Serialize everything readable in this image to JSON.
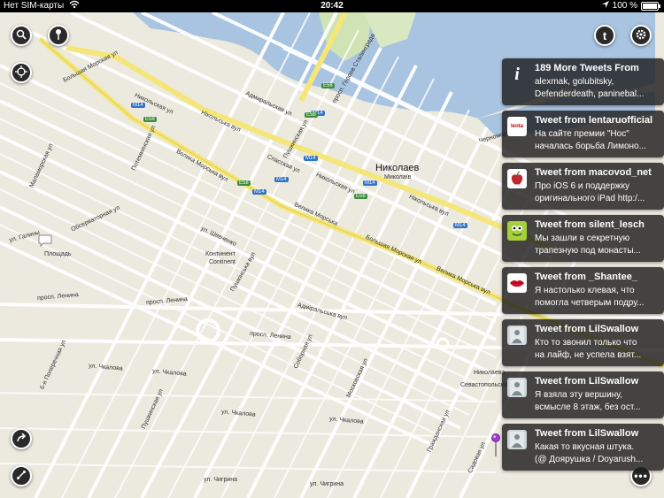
{
  "status_bar": {
    "carrier": "Нет SIM-карты",
    "time": "20:42",
    "battery": "100 %",
    "battery_level": 1.0
  },
  "map": {
    "city": "Николаев",
    "city_small": "Миколаїв",
    "labels": {
      "bolshaya_morskaya_1": "Большая Морская ул",
      "velyka_morska_1": "Велика Морська вул",
      "nikolskaya": "Никольская ул",
      "nikolska_ua": "Нікольська вул",
      "nikolskaya_2": "Никольская ул",
      "nikolska_ua_2": "Нікольська вул",
      "velyka_morska_2": "Велика Морська",
      "bolshaya_morskaya_2": "Большая Морская ул",
      "velyka_morska_3": "Велика Морська вул",
      "prosp_lenina_1": "просп. Ленина",
      "prosp_lenina_2": "просп. Ленина",
      "prosp_lenina_3": "просп. Ленина",
      "chkalova_1": "ул. Чкалова",
      "chkalova_2": "ул. Чкалова",
      "chkalova_3": "ул. Чкалова",
      "chkalova_4": "ул. Чкалова",
      "chigrina_1": "ул. Чигрина",
      "chigrina_2": "ул. Чигрина",
      "pushkinskaya_1": "Пушкинская ул",
      "pushkinskaya_2": "Пушкинская ул",
      "pushkinska": "Пушкінська вул",
      "spasskaya": "Спасская ул",
      "admiralskaya": "Адмиральская ул",
      "admiralska": "Адміральська вул",
      "shevchenko": "ул. Шевченко",
      "potemkinskaya": "Потемкинская ул",
      "sobornaya": "Соборная ул",
      "moskovskaya": "Московская ул",
      "kontinent": "Континент",
      "kontinent_ua": "Continent",
      "geroev_stalingrada": "просп. Героев Сталинграда",
      "ploshchad": "Площадь",
      "obserwatornaya": "Обсерваторная ул",
      "galiny": "ул. Галины",
      "poperechnaya": "6-я Поперечная ул",
      "mala_morska": "Маламорская ул",
      "sevastopolskaya": "Севастопольская ул",
      "gradanskaya": "Гражданская ул",
      "sennaya": "Садовая ул",
      "chernomorskaya": "Черноморская ул",
      "nikolayeva": "Николаева"
    },
    "badges": {
      "m14_1": "M14",
      "m14_2": "M14",
      "m14_3": "M14",
      "m14_4": "M14",
      "m14_5": "M14",
      "m14_6": "M14",
      "m14_7": "M14",
      "e58_1": "E58",
      "e58_2": "E58",
      "e58_3": "E58",
      "e58_4": "E58",
      "e58_5": "E58"
    }
  },
  "controls": {
    "search_icon": "search-icon",
    "pin_icon": "map-pin-icon",
    "locate_icon": "crosshair-icon",
    "twitter_icon": "twitter-icon",
    "settings_icon": "gear-icon",
    "share_icon": "share-arrow-icon",
    "route_icon": "route-icon",
    "more_icon": "ellipsis-icon",
    "chat_icon": "speech-bubble-icon"
  },
  "tweets": [
    {
      "title": "189 More Tweets From",
      "line1": "alexmak, golubitsky,",
      "line2": "Defenderdeath, paninebal...",
      "avatar": "info-icon"
    },
    {
      "title": "Tweet from lentaruofficial",
      "line1": "На сайте премии \"Нос\"",
      "line2": "началась борьба Лимоно...",
      "avatar": "lenta-avatar"
    },
    {
      "title": "Tweet from macovod_net",
      "line1": "Про iOS 6 и поддержку",
      "line2": "оригинального iPad http:/...",
      "avatar": "apple-avatar"
    },
    {
      "title": "Tweet from silent_lesch",
      "line1": "Мы зашли в секретную",
      "line2": "трапезную под монасты...",
      "avatar": "frog-avatar"
    },
    {
      "title": "Tweet from _Shantee_",
      "line1": "Я настолько клевая, что",
      "line2": "помогла четверым подру...",
      "avatar": "lips-avatar"
    },
    {
      "title": "Tweet from LilSwallow",
      "line1": "Кто то звонил только что",
      "line2": "на лайф, не успела взят...",
      "avatar": "photo-avatar"
    },
    {
      "title": "Tweet from LilSwallow",
      "line1": "Я взяла эту вершину,",
      "line2": "всмысле 8 этаж, без ост...",
      "avatar": "photo-avatar"
    },
    {
      "title": "Tweet from LilSwallow",
      "line1": "Какая то вкусная штука.",
      "line2": "(@ Доярушка / Doyarush...",
      "avatar": "photo-avatar"
    }
  ],
  "colors": {
    "map_bg": "#ece9df",
    "water": "#a8c4e0",
    "park": "#cfe3b5",
    "major_road": "#f5e67a",
    "road": "#ffffff",
    "card_bg": "#1e1e1e"
  }
}
